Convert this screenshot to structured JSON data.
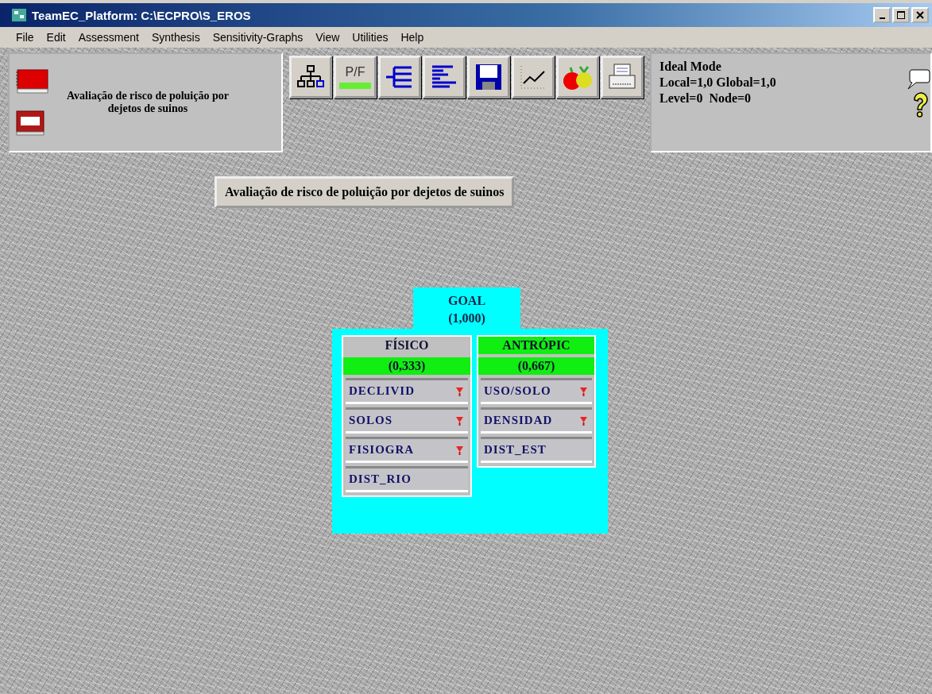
{
  "window": {
    "title": "TeamEC_Platform: C:\\ECPRO\\S_EROS"
  },
  "menu": [
    "File",
    "Edit",
    "Assessment",
    "Synthesis",
    "Sensitivity-Graphs",
    "View",
    "Utilities",
    "Help"
  ],
  "model_panel": {
    "title": "Avaliação de risco de poluição por dejetos de suinos"
  },
  "toolbar": [
    {
      "kind": "hierarchy"
    },
    {
      "kind": "pf",
      "label": "P/F"
    },
    {
      "kind": "tree"
    },
    {
      "kind": "bars"
    },
    {
      "kind": "save"
    },
    {
      "kind": "graph"
    },
    {
      "kind": "fruit"
    },
    {
      "kind": "print"
    }
  ],
  "status_panel": {
    "mode": "Ideal Mode",
    "weights": "Local=1,0 Global=1,0",
    "position": "Level=0  Node=0"
  },
  "banner": "Avaliação de risco de poluição por dejetos de suinos",
  "goal": {
    "name": "GOAL",
    "value": "(1,000)"
  },
  "criteria": [
    {
      "name": "FÍSICO",
      "value": "(0,333)",
      "selected": false,
      "children": [
        {
          "name": "DECLIVID",
          "expandable": true
        },
        {
          "name": "SOLOS",
          "expandable": true
        },
        {
          "name": "FISIOGRA",
          "expandable": true
        },
        {
          "name": "DIST_RIO",
          "expandable": false
        }
      ]
    },
    {
      "name": "ANTRÓPIC",
      "value": "(0,667)",
      "selected": true,
      "children": [
        {
          "name": "USO/SOLO",
          "expandable": true
        },
        {
          "name": "DENSIDAD",
          "expandable": true
        },
        {
          "name": "DIST_EST",
          "expandable": false
        }
      ]
    }
  ]
}
